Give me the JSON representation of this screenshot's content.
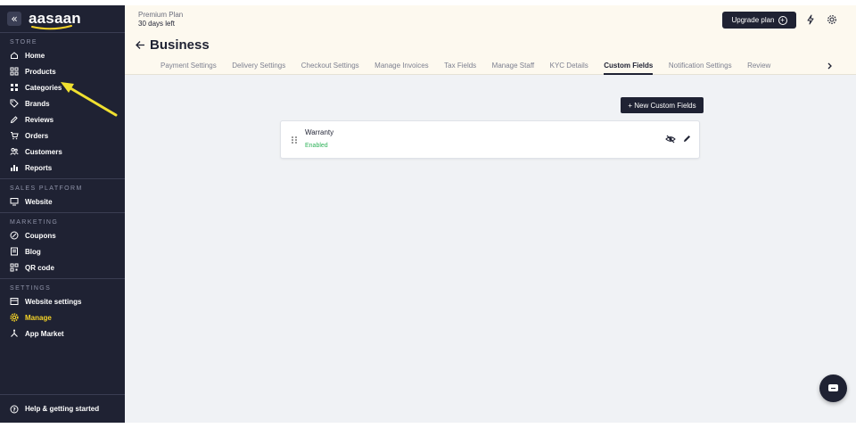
{
  "plan": {
    "name": "Premium Plan",
    "days_left": "30 days left"
  },
  "header": {
    "upgrade_label": "Upgrade plan",
    "page_title": "Business"
  },
  "tabs": [
    {
      "label": "Payment Settings"
    },
    {
      "label": "Delivery Settings"
    },
    {
      "label": "Checkout Settings"
    },
    {
      "label": "Manage Invoices"
    },
    {
      "label": "Tax Fields"
    },
    {
      "label": "Manage Staff"
    },
    {
      "label": "KYC Details"
    },
    {
      "label": "Custom Fields",
      "active": true
    },
    {
      "label": "Notification Settings"
    },
    {
      "label": "Review"
    }
  ],
  "sidebar": {
    "logo": "aasaan",
    "sections": {
      "store": "STORE",
      "sales_platform": "SALES PLATFORM",
      "marketing": "MARKETING",
      "settings": "SETTINGS"
    },
    "store_items": [
      {
        "label": "Home",
        "icon": "home-icon"
      },
      {
        "label": "Products",
        "icon": "products-icon"
      },
      {
        "label": "Categories",
        "icon": "categories-icon"
      },
      {
        "label": "Brands",
        "icon": "tag-icon"
      },
      {
        "label": "Reviews",
        "icon": "reviews-icon"
      },
      {
        "label": "Orders",
        "icon": "cart-icon"
      },
      {
        "label": "Customers",
        "icon": "customers-icon"
      },
      {
        "label": "Reports",
        "icon": "reports-icon"
      }
    ],
    "sales_items": [
      {
        "label": "Website",
        "icon": "monitor-icon"
      }
    ],
    "marketing_items": [
      {
        "label": "Coupons",
        "icon": "coupon-icon"
      },
      {
        "label": "Blog",
        "icon": "blog-icon"
      },
      {
        "label": "QR code",
        "icon": "qr-icon"
      }
    ],
    "settings_items": [
      {
        "label": "Website settings",
        "icon": "website-settings-icon"
      },
      {
        "label": "Manage",
        "icon": "gear-icon",
        "active": true
      },
      {
        "label": "App Market",
        "icon": "app-market-icon"
      }
    ],
    "footer": "Help & getting started"
  },
  "main": {
    "new_button_label": "+ New Custom Fields",
    "fields": [
      {
        "name": "Warranty",
        "status": "Enabled"
      }
    ]
  },
  "colors": {
    "sidebar_bg": "#1f2233",
    "active_accent": "#f5d327",
    "enabled_green": "#2fb25a",
    "annotation_arrow": "#f0e030"
  }
}
